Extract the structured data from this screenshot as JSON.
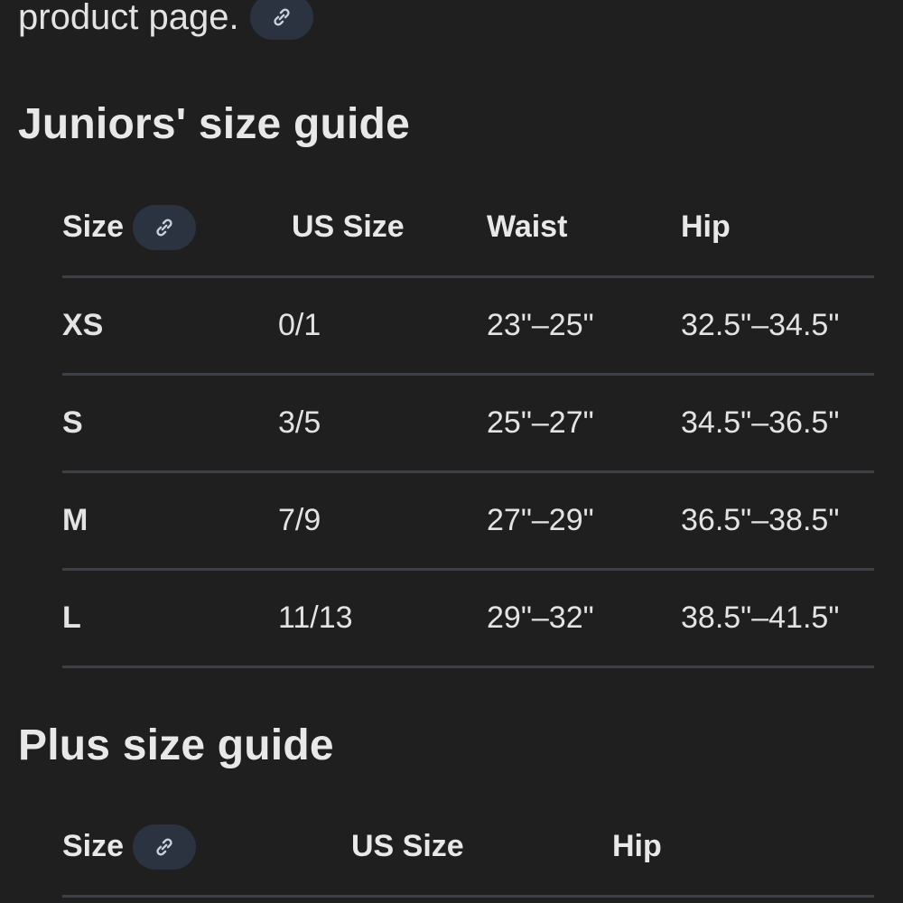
{
  "intro": {
    "text": "product page."
  },
  "juniors": {
    "title": "Juniors' size guide",
    "headers": [
      "Size",
      "US Size",
      "Waist",
      "Hip"
    ],
    "rows": [
      {
        "size": "XS",
        "us_size": "0/1",
        "waist": "23\"–25\"",
        "hip": "32.5\"–34.5\""
      },
      {
        "size": "S",
        "us_size": "3/5",
        "waist": "25\"–27\"",
        "hip": "34.5\"–36.5\""
      },
      {
        "size": "M",
        "us_size": "7/9",
        "waist": "27\"–29\"",
        "hip": "36.5\"–38.5\""
      },
      {
        "size": "L",
        "us_size": "11/13",
        "waist": "29\"–32\"",
        "hip": "38.5\"–41.5\""
      }
    ]
  },
  "plus": {
    "title": "Plus size guide",
    "headers": [
      "Size",
      "US Size",
      "Hip"
    ]
  },
  "icons": {
    "link": "link-icon"
  },
  "colors": {
    "background": "#1f1f1f",
    "chip": "#2c3340",
    "divider": "#3c4049",
    "text": "#e3e3e3"
  }
}
